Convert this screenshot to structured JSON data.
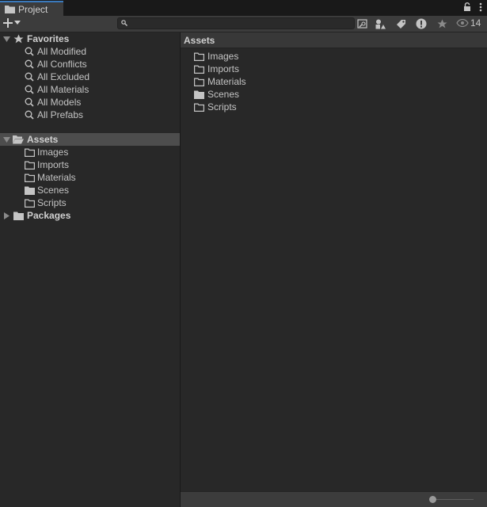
{
  "window": {
    "tab_title": "Project"
  },
  "toolbar": {
    "search": {
      "placeholder": "",
      "value": ""
    },
    "visibility_count": "14"
  },
  "sidebar": {
    "favorites": {
      "label": "Favorites",
      "items": [
        "All Modified",
        "All Conflicts",
        "All Excluded",
        "All Materials",
        "All Models",
        "All Prefabs"
      ]
    },
    "assets": {
      "label": "Assets",
      "children": [
        "Images",
        "Imports",
        "Materials",
        "Scenes",
        "Scripts"
      ]
    },
    "packages": {
      "label": "Packages"
    }
  },
  "content": {
    "breadcrumb": "Assets",
    "items": [
      {
        "label": "Images",
        "icon": "folder-outline-icon"
      },
      {
        "label": "Imports",
        "icon": "folder-outline-icon"
      },
      {
        "label": "Materials",
        "icon": "folder-outline-icon"
      },
      {
        "label": "Scenes",
        "icon": "folder-filled-icon"
      },
      {
        "label": "Scripts",
        "icon": "folder-outline-icon"
      }
    ]
  },
  "footer": {
    "zoom_fraction": 0.0
  },
  "colors": {
    "background": "#282828",
    "toolbar": "#3c3c3c",
    "selection": "#4d4d4d",
    "tab_accent": "#3a79bb",
    "text": "#c4c4c4"
  }
}
